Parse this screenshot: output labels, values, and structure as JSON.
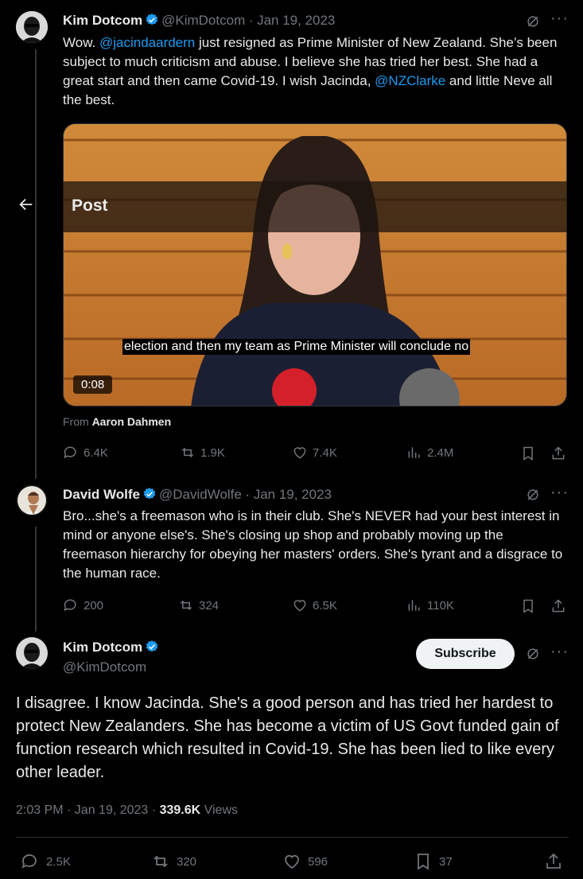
{
  "header": {
    "title": "Post",
    "back_label": "←"
  },
  "tweet1": {
    "name": "Kim Dotcom",
    "handle": "@KimDotcom",
    "date": "· Jan 19, 2023",
    "text_before": "Wow. ",
    "mention1": "@jacindaardern",
    "text_mid": " just resigned as Prime Minister of New Zealand. She’s been subject to much criticism and abuse. I believe she has tried her best. She had a great start and then came Covid-19. I wish Jacinda, ",
    "mention2": "@NZClarke",
    "text_after": " and little Neve all the best.",
    "video": {
      "caption": "election and then my team as Prime Minister will conclude no",
      "timestamp": "0:08"
    },
    "from_label": "From",
    "from_name": "Aaron Dahmen",
    "replies": "6.4K",
    "reposts": "1.9K",
    "likes": "7.4K",
    "views": "2.4M"
  },
  "tweet2": {
    "name": "David Wolfe",
    "handle": "@DavidWolfe",
    "date": "· Jan 19, 2023",
    "text": "Bro...she's a freemason who is in their club. She's NEVER had your best interest in mind or anyone else's. She's closing up shop and probably moving up the freemason hierarchy for obeying her masters' orders. She's tyrant and a disgrace to the human race.",
    "replies": "200",
    "reposts": "324",
    "likes": "6.5K",
    "views": "110K"
  },
  "main": {
    "name": "Kim Dotcom",
    "handle": "@KimDotcom",
    "subscribe_label": "Subscribe",
    "text": "I disagree. I know Jacinda. She's a good person and has tried her hardest to protect New Zealanders. She has become a victim of US Govt funded gain of function research which resulted in Covid-19. She has been lied to like every other leader.",
    "time": "2:03 PM · Jan 19, 2023 ·",
    "views_count": "339.6K",
    "views_label": "Views",
    "replies": "2.5K",
    "reposts": "320",
    "likes": "596",
    "bookmarks": "37"
  },
  "colors": {
    "accent": "#1d9bf0",
    "muted": "#71767b",
    "background": "#000000"
  }
}
